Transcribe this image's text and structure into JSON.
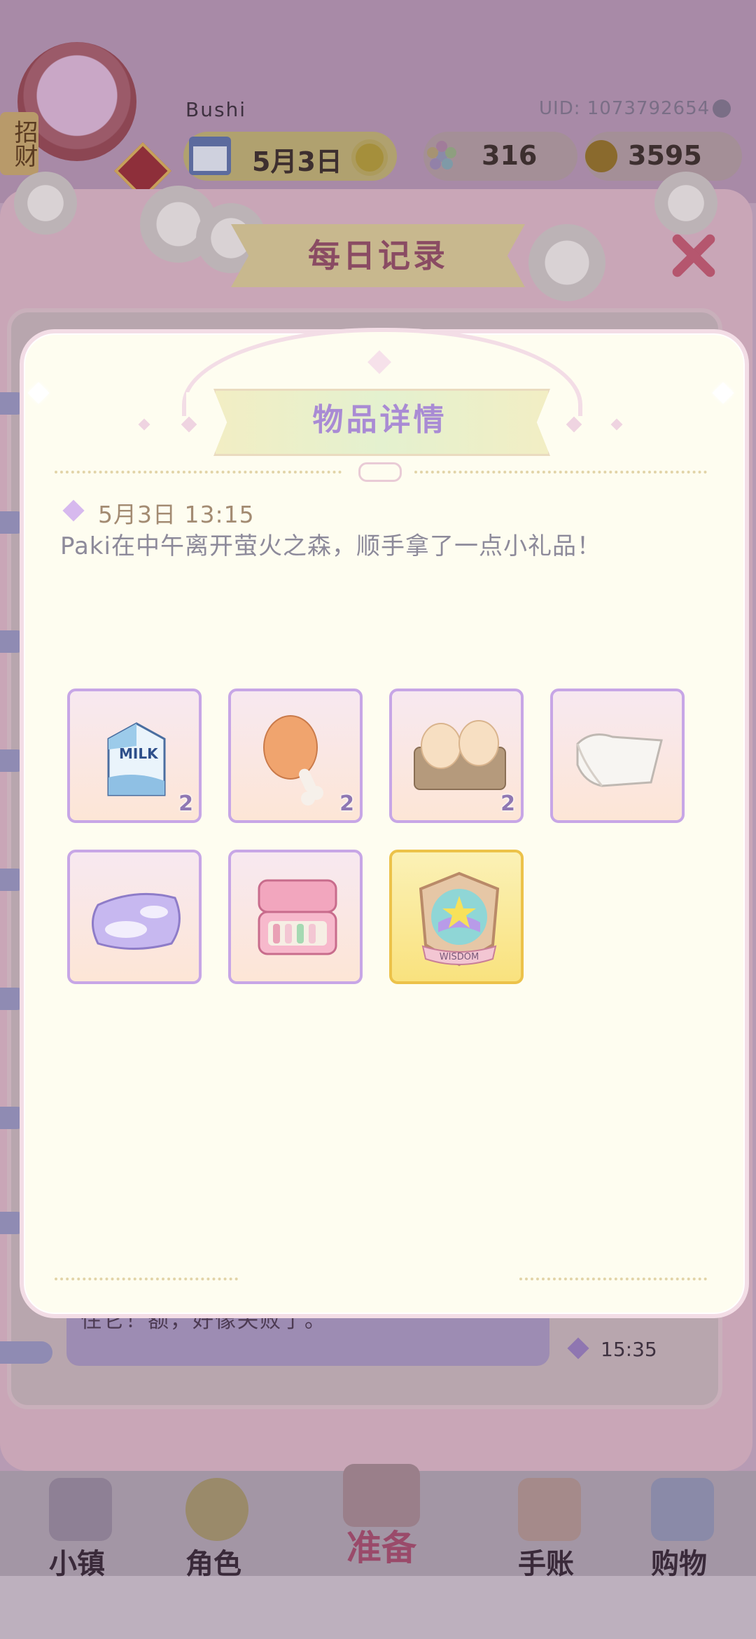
{
  "hud": {
    "username": "Bushi",
    "uid": "UID: 1073792654",
    "date": "5月3日",
    "gems": "316",
    "coins": "3595",
    "emblem_tag": "招财"
  },
  "records": {
    "title": "每日记录",
    "note_text": "住它！额，好像失败了。",
    "note_time": "15:35"
  },
  "nav": {
    "items": [
      "小镇",
      "角色",
      "准备",
      "手账",
      "购物"
    ]
  },
  "modal": {
    "title": "物品详情",
    "entry_time": "5月3日 13:15",
    "entry_text": "Paki在中午离开萤火之森，顺手拿了一点小礼品！",
    "items": [
      {
        "icon": "milk-carton-icon",
        "count": "2"
      },
      {
        "icon": "chicken-drumstick-icon",
        "count": "2"
      },
      {
        "icon": "egg-carton-icon",
        "count": "2"
      },
      {
        "icon": "towel-icon",
        "count": ""
      },
      {
        "icon": "cushion-icon",
        "count": ""
      },
      {
        "icon": "lipstick-case-icon",
        "count": ""
      },
      {
        "icon": "wisdom-badge-icon",
        "count": "",
        "label": "WISDOM",
        "highlight": true
      }
    ]
  },
  "colors": {
    "modal_bg": "#fefdf0",
    "slot_border": "#c7a6e6",
    "title_text": "#a98bd4",
    "gold_slot": "#ecc24a"
  }
}
